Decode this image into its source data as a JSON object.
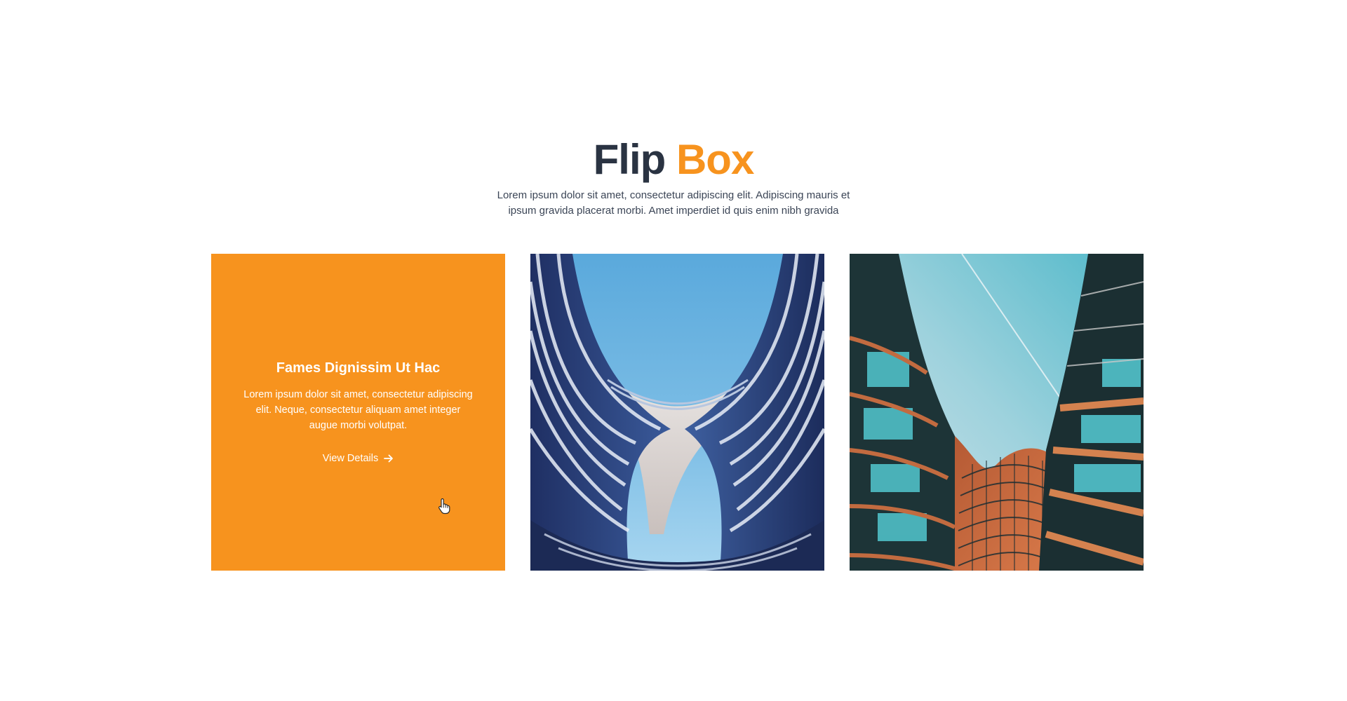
{
  "header": {
    "title_dark": "Flip",
    "title_accent": "Box",
    "subtitle": "Lorem ipsum dolor sit amet, consectetur adipiscing elit. Adipiscing mauris et ipsum gravida placerat morbi. Amet imperdiet id quis enim nibh gravida"
  },
  "colors": {
    "accent": "#f7931e",
    "heading": "#2a3342",
    "body_text": "#3b4556"
  },
  "cards": [
    {
      "title": "Fames Dignissim Ut Hac",
      "text": "Lorem ipsum dolor sit amet, consectetur adipiscing elit. Neque, consectetur aliquam amet integer augue morbi volutpat.",
      "link_label": "View Details",
      "link_icon": "arrow-right-icon",
      "state": "flipped"
    },
    {
      "image": "curved-blue-white-building-photo"
    },
    {
      "image": "copper-glass-curved-building-photo"
    }
  ],
  "cursor": "hand-pointer-icon"
}
